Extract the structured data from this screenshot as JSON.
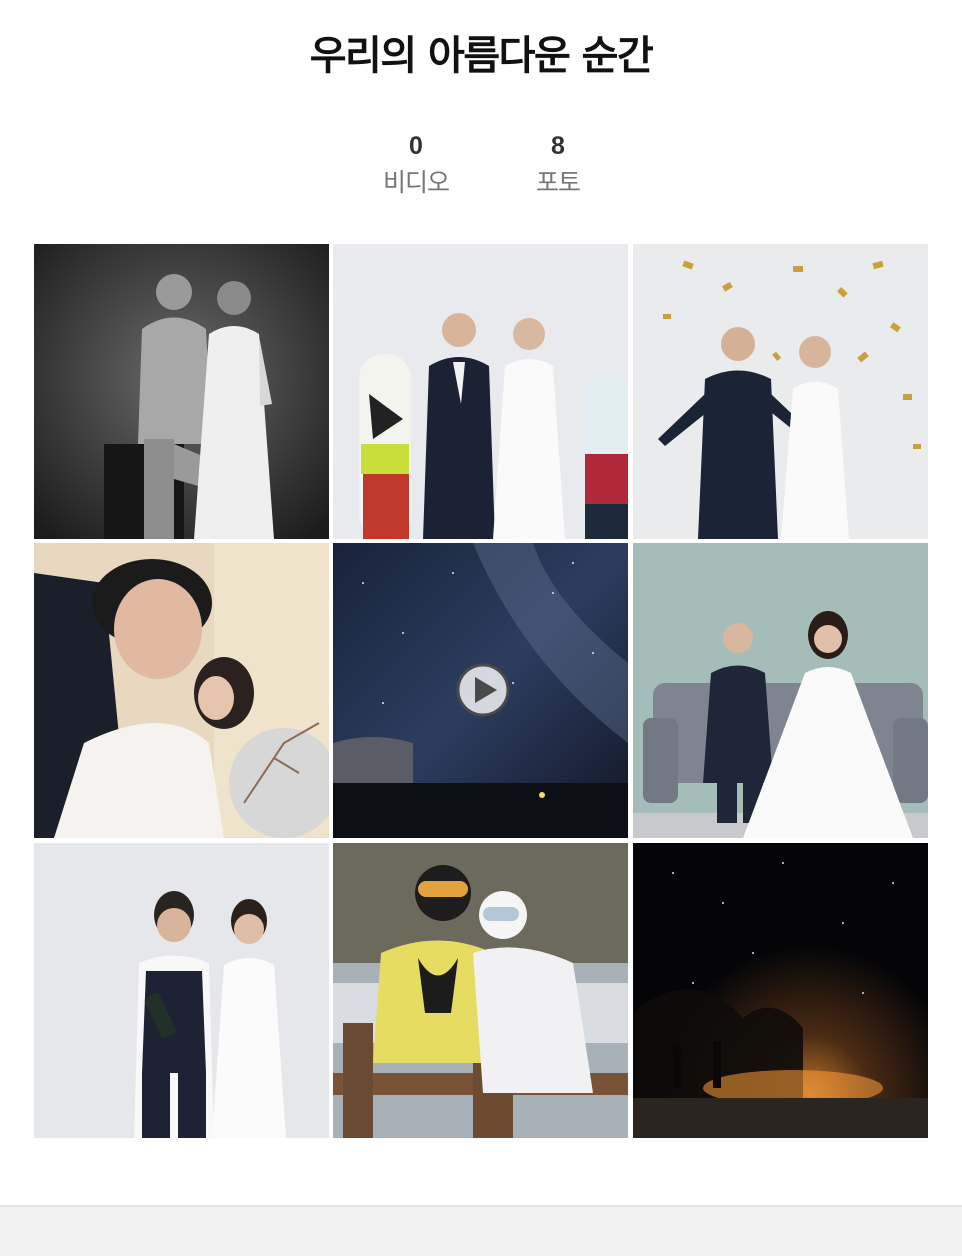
{
  "title": "우리의 아름다운 순간",
  "stats": {
    "video": {
      "count": "0",
      "label": "비디오"
    },
    "photo": {
      "count": "8",
      "label": "포토"
    }
  },
  "gallery": {
    "items": [
      {
        "kind": "photo",
        "icon": "bw-studio-photo"
      },
      {
        "kind": "photo",
        "icon": "snowboard-studio-photo"
      },
      {
        "kind": "photo",
        "icon": "confetti-photo"
      },
      {
        "kind": "photo",
        "icon": "selfie-photo"
      },
      {
        "kind": "video",
        "icon": "milky-way-video"
      },
      {
        "kind": "photo",
        "icon": "sofa-photo"
      },
      {
        "kind": "photo",
        "icon": "champagne-photo"
      },
      {
        "kind": "photo",
        "icon": "ski-slope-photo"
      },
      {
        "kind": "photo",
        "icon": "night-sky-photo"
      }
    ]
  },
  "colors": {
    "title": "#111111",
    "count": "#333333",
    "label": "#777777",
    "footer": "#f2f2f2"
  }
}
